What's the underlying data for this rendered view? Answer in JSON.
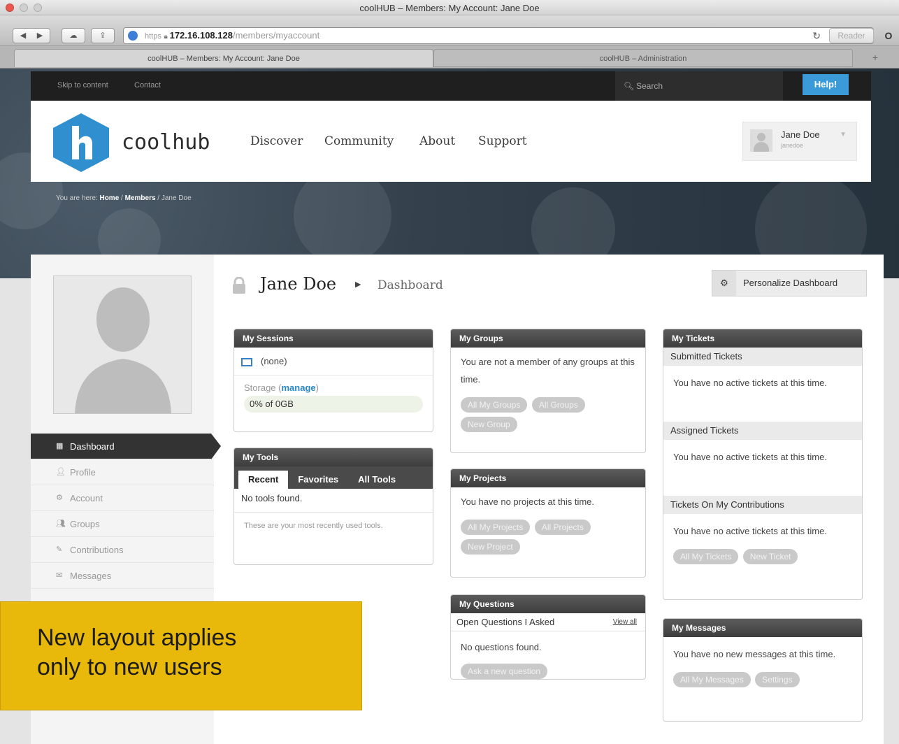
{
  "window": {
    "title": "coolHUB – Members: My Account: Jane Doe"
  },
  "browser": {
    "url_scheme": "https",
    "url_host": "172.16.108.128",
    "url_path": "/members/myaccount",
    "reader_label": "Reader",
    "tabs": [
      {
        "label": "coolHUB – Members: My Account: Jane Doe",
        "active": true
      },
      {
        "label": "coolHUB – Administration",
        "active": false
      }
    ]
  },
  "topnav": {
    "skip_label": "Skip to content",
    "contact_label": "Contact",
    "search_placeholder": "Search",
    "help_label": "Help!"
  },
  "header": {
    "logo_letter": "h",
    "logo_text": "coolhub",
    "nav": [
      "Discover",
      "Community",
      "About",
      "Support"
    ],
    "user_name": "Jane Doe",
    "user_handle": "janedoe"
  },
  "breadcrumb": {
    "prefix": "You are here:",
    "items": [
      "Home",
      "Members",
      "Jane Doe"
    ]
  },
  "sidebar": {
    "items": [
      {
        "label": "Dashboard",
        "icon": "dashboard-icon",
        "active": true
      },
      {
        "label": "Profile",
        "icon": "user-icon"
      },
      {
        "label": "Account",
        "icon": "gears-icon"
      },
      {
        "label": "Groups",
        "icon": "group-icon"
      },
      {
        "label": "Contributions",
        "icon": "pencil-icon"
      },
      {
        "label": "Messages",
        "icon": "envelope-icon"
      }
    ]
  },
  "title": {
    "name": "Jane Doe",
    "section": "Dashboard",
    "personalize_label": "Personalize Dashboard"
  },
  "modules": {
    "sessions": {
      "title": "My Sessions",
      "none": "(none)",
      "storage_label": "Storage",
      "manage_label": "manage",
      "storage_value": "0% of 0GB"
    },
    "tools": {
      "title": "My Tools",
      "tabs": [
        "Recent",
        "Favorites",
        "All Tools"
      ],
      "empty": "No tools found.",
      "note": "These are your most recently used tools."
    },
    "groups": {
      "title": "My Groups",
      "text": "You are not a member of any groups at this time.",
      "buttons": [
        "All My Groups",
        "All Groups",
        "New Group"
      ]
    },
    "projects": {
      "title": "My Projects",
      "text": "You have no projects at this time.",
      "buttons": [
        "All My Projects",
        "All Projects",
        "New Project"
      ]
    },
    "questions": {
      "title": "My Questions",
      "subhead": "Open Questions I Asked",
      "view_all": "View all",
      "text": "No questions found.",
      "button": "Ask a new question"
    },
    "tickets": {
      "title": "My Tickets",
      "sections": [
        {
          "head": "Submitted Tickets",
          "text": "You have no active tickets at this time."
        },
        {
          "head": "Assigned Tickets",
          "text": "You have no active tickets at this time."
        },
        {
          "head": "Tickets On My Contributions",
          "text": "You have no active tickets at this time."
        }
      ],
      "buttons": [
        "All My Tickets",
        "New Ticket"
      ]
    },
    "messages": {
      "title": "My Messages",
      "text": "You have no new messages at this time.",
      "buttons": [
        "All My Messages",
        "Settings"
      ]
    }
  },
  "callout": {
    "text_line1": "New layout applies",
    "text_line2": "only to new users"
  }
}
